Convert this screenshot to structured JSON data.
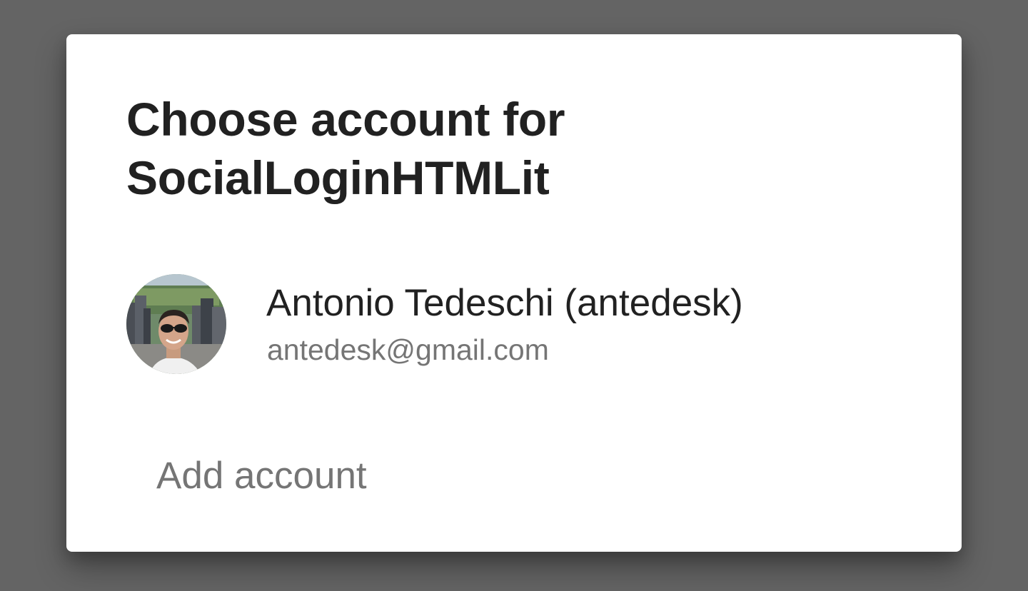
{
  "dialog": {
    "title": "Choose account for SocialLoginHTMLit",
    "accounts": [
      {
        "name": "Antonio Tedeschi (antedesk)",
        "email": "antedesk@gmail.com",
        "avatar": "profile-photo"
      }
    ],
    "add_account_label": "Add account"
  },
  "colors": {
    "scrim": "#646464",
    "surface": "#ffffff",
    "primary_text": "#212121",
    "secondary_text": "#757575"
  }
}
